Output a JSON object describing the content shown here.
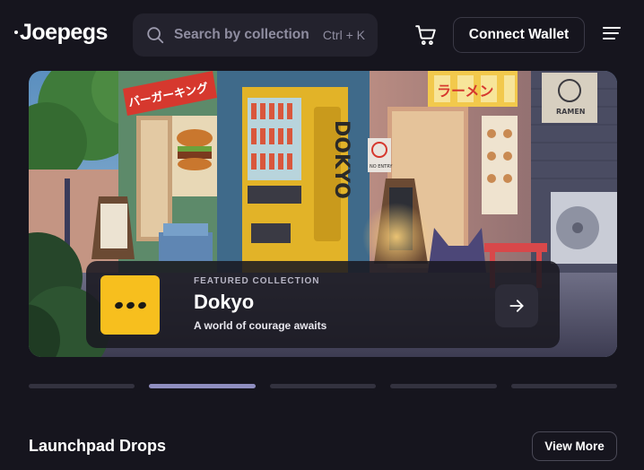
{
  "header": {
    "logo_text": "Joepegs",
    "search_placeholder": "Search by collections",
    "search_shortcut": "Ctrl + K",
    "connect_wallet_label": "Connect Wallet"
  },
  "banner": {
    "signs": {
      "burger_sign": "バーガーキング",
      "ramen_sign": "ラーメン",
      "ramen_logo_text": "RAMEN",
      "vending_brand": "DOKYO",
      "no_entry": "NO ENTRY"
    },
    "featured": {
      "label": "FEATURED COLLECTION",
      "name": "Dokyo",
      "description": "A world of courage awaits"
    }
  },
  "carousel": {
    "count": 5,
    "active_index": 1
  },
  "section": {
    "title": "Launchpad Drops",
    "view_more_label": "View More"
  },
  "colors": {
    "background": "#16151e",
    "search_bg": "#23222d",
    "accent_yellow": "#f7bf1e",
    "indicator_active": "#8f8ec0",
    "indicator_inactive": "#33323f"
  }
}
